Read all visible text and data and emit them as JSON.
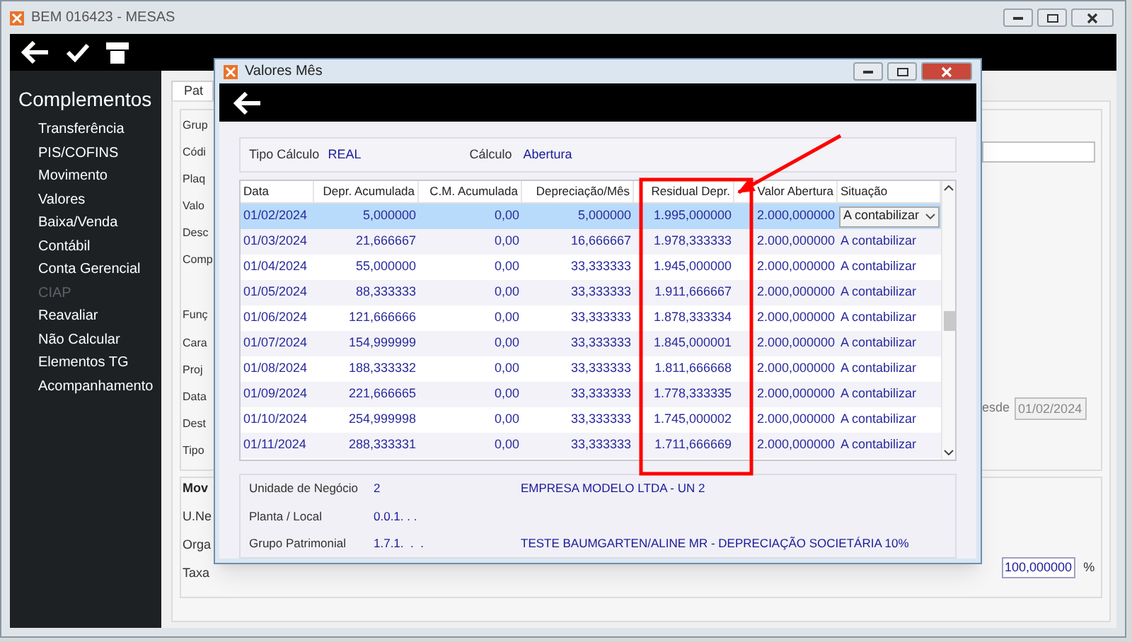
{
  "main_window": {
    "title": "BEM 016423 - MESAS"
  },
  "sidebar": {
    "title": "Complementos",
    "items": [
      {
        "label": "Transferência",
        "disabled": false
      },
      {
        "label": "PIS/COFINS",
        "disabled": false
      },
      {
        "label": "Movimento",
        "disabled": false
      },
      {
        "label": "Valores",
        "disabled": false
      },
      {
        "label": "Baixa/Venda",
        "disabled": false
      },
      {
        "label": "Contábil",
        "disabled": false
      },
      {
        "label": "Conta Gerencial",
        "disabled": false
      },
      {
        "label": "CIAP",
        "disabled": true
      },
      {
        "label": "Reavaliar",
        "disabled": false
      },
      {
        "label": "Não Calcular",
        "disabled": false
      },
      {
        "label": "Elementos TG",
        "disabled": false
      },
      {
        "label": "Acompanhamento",
        "disabled": false
      }
    ]
  },
  "main_panel": {
    "tab": "Pat",
    "labels": [
      "Grup",
      "Códi",
      "Plaq",
      "Valo",
      "Desc",
      "Comp",
      "Funç",
      "Cara",
      "Proj",
      "Data",
      "Dest",
      "Tipo"
    ],
    "section_title": "Mov",
    "section_labels": [
      "U.Ne",
      "Orga",
      "Taxa"
    ],
    "date_label": "esde",
    "date_value": "01/02/2024",
    "rate_value": "100,000000",
    "rate_unit": "%"
  },
  "dialog": {
    "title": "Valores Mês",
    "tipo_calculo_label": "Tipo Cálculo",
    "tipo_calculo": "REAL",
    "calculo_label": "Cálculo",
    "calculo": "Abertura",
    "table": {
      "columns": [
        "Data",
        "Depr. Acumulada",
        "C.M. Acumulada",
        "Depreciação/Mês",
        "Residual Depr.",
        "Valor Abertura",
        "Situação"
      ],
      "rows": [
        {
          "selected": true,
          "cells": [
            "01/02/2024",
            "5,000000",
            "0,00",
            "5,000000",
            "1.995,000000",
            "2.000,000000",
            "A contabilizar"
          ]
        },
        {
          "selected": false,
          "cells": [
            "01/03/2024",
            "21,666667",
            "0,00",
            "16,666667",
            "1.978,333333",
            "2.000,000000",
            "A contabilizar"
          ]
        },
        {
          "selected": false,
          "cells": [
            "01/04/2024",
            "55,000000",
            "0,00",
            "33,333333",
            "1.945,000000",
            "2.000,000000",
            "A contabilizar"
          ]
        },
        {
          "selected": false,
          "cells": [
            "01/05/2024",
            "88,333333",
            "0,00",
            "33,333333",
            "1.911,666667",
            "2.000,000000",
            "A contabilizar"
          ]
        },
        {
          "selected": false,
          "cells": [
            "01/06/2024",
            "121,666666",
            "0,00",
            "33,333333",
            "1.878,333334",
            "2.000,000000",
            "A contabilizar"
          ]
        },
        {
          "selected": false,
          "cells": [
            "01/07/2024",
            "154,999999",
            "0,00",
            "33,333333",
            "1.845,000001",
            "2.000,000000",
            "A contabilizar"
          ]
        },
        {
          "selected": false,
          "cells": [
            "01/08/2024",
            "188,333332",
            "0,00",
            "33,333333",
            "1.811,666668",
            "2.000,000000",
            "A contabilizar"
          ]
        },
        {
          "selected": false,
          "cells": [
            "01/09/2024",
            "221,666665",
            "0,00",
            "33,333333",
            "1.778,333335",
            "2.000,000000",
            "A contabilizar"
          ]
        },
        {
          "selected": false,
          "cells": [
            "01/10/2024",
            "254,999998",
            "0,00",
            "33,333333",
            "1.745,000002",
            "2.000,000000",
            "A contabilizar"
          ]
        },
        {
          "selected": false,
          "cells": [
            "01/11/2024",
            "288,333331",
            "0,00",
            "33,333333",
            "1.711,666669",
            "2.000,000000",
            "A contabilizar"
          ]
        }
      ]
    },
    "details": [
      {
        "label": "Unidade de Negócio",
        "code": "2",
        "description": "EMPRESA MODELO LTDA - UN 2"
      },
      {
        "label": "Planta / Local",
        "code": "0.0.1. . ."
      },
      {
        "label": "Grupo Patrimonial",
        "code": "1.7.1.  .  .",
        "description": "TESTE BAUMGARTEN/ALINE MR - DEPRECIAÇÃO SOCIETÁRIA 10%"
      }
    ]
  }
}
